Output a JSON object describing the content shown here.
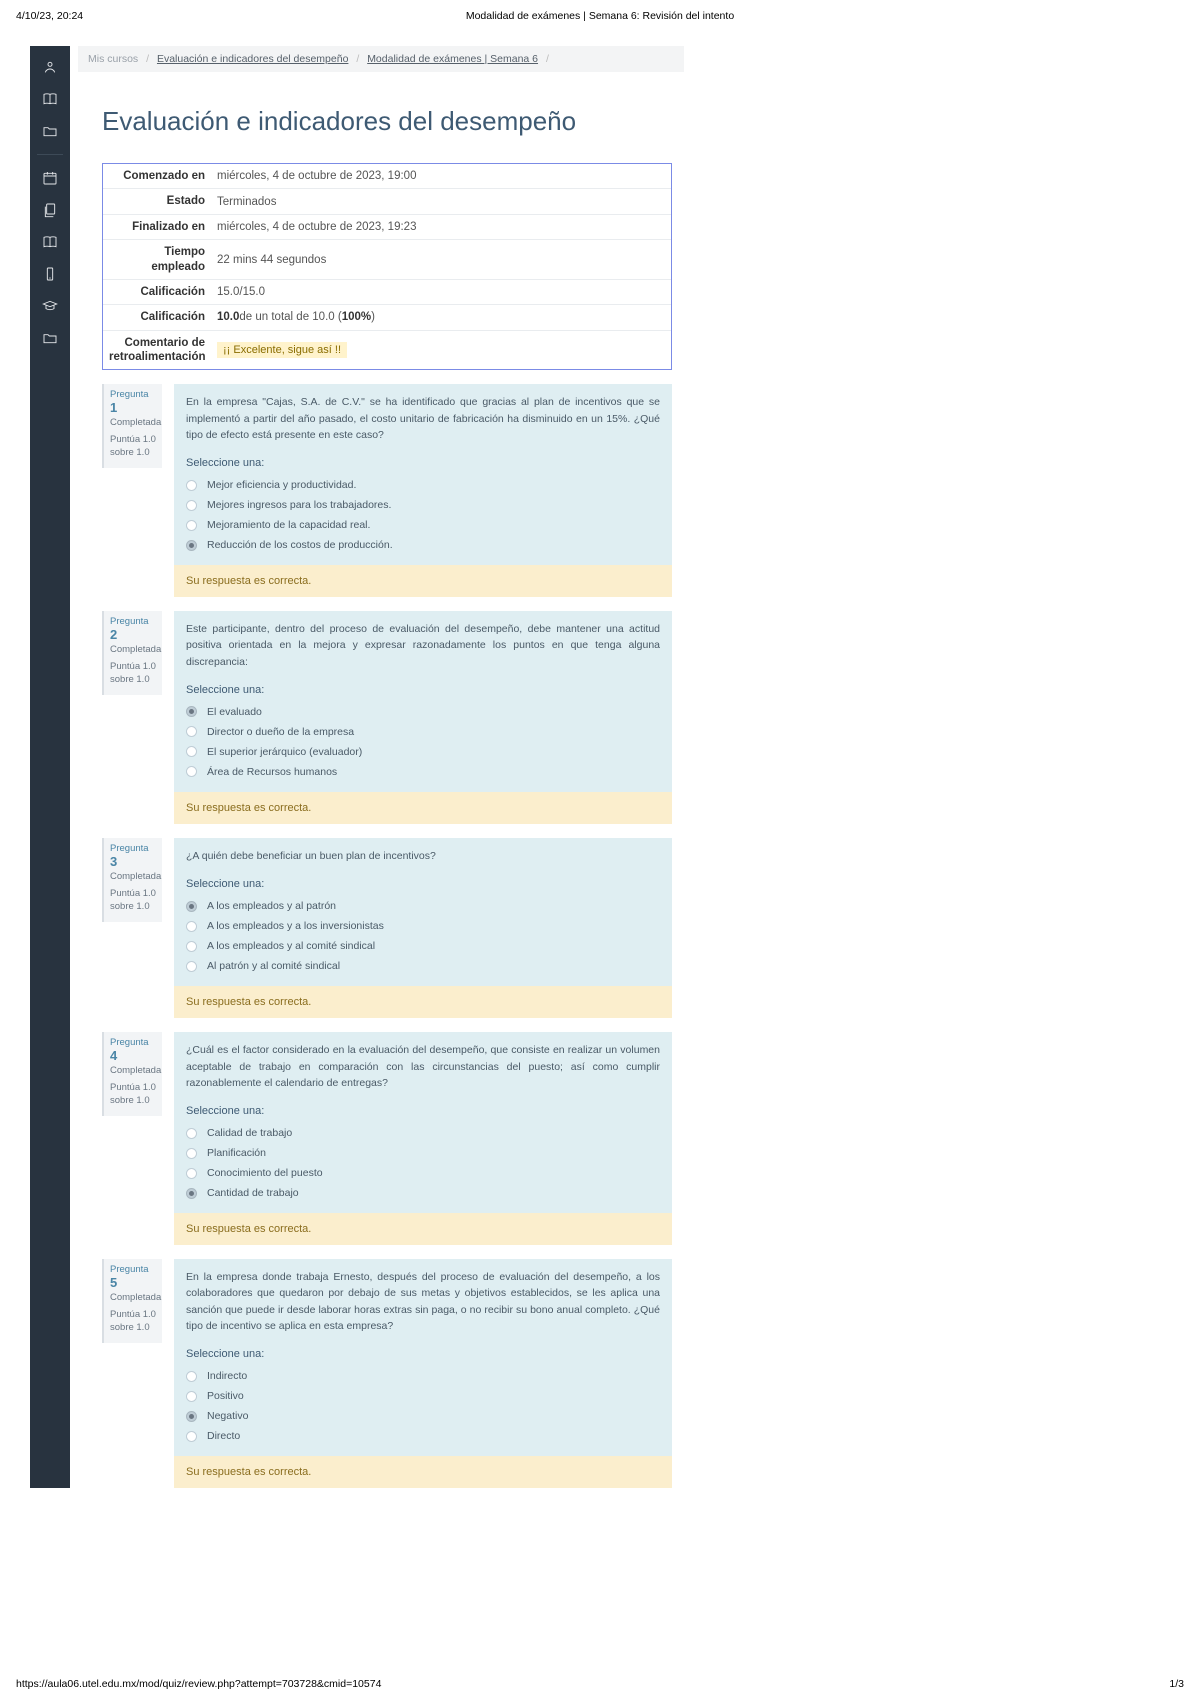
{
  "print": {
    "datetime": "4/10/23, 20:24",
    "title": "Modalidad de exámenes | Semana 6: Revisión del intento",
    "url": "https://aula06.utel.edu.mx/mod/quiz/review.php?attempt=703728&cmid=10574",
    "pagination": "1/3"
  },
  "breadcrumb": {
    "root": "Mis cursos",
    "course": "Evaluación e indicadores del desempeño",
    "page": "Modalidad de exámenes | Semana 6"
  },
  "page_title": "Evaluación e indicadores del desempeño",
  "summary": {
    "rows": [
      {
        "label": "Comenzado en",
        "value": "miércoles, 4 de octubre de 2023, 19:00"
      },
      {
        "label": "Estado",
        "value": "Terminados"
      },
      {
        "label": "Finalizado en",
        "value": "miércoles, 4 de octubre de 2023, 19:23"
      },
      {
        "label": "Tiempo empleado",
        "value": "22 mins 44 segundos"
      },
      {
        "label": "Calificación",
        "value": "15.0/15.0"
      },
      {
        "label": "Calificación",
        "value_html": "<b>10.0</b> de un total de 10.0 (<b>100%</b>)"
      },
      {
        "label": "Comentario de retroalimentación",
        "badge": "¡¡ Excelente, sigue así !!"
      }
    ]
  },
  "question_labels": {
    "label": "Pregunta",
    "status": "Completada",
    "score_prefix": "Puntúa 1.0 sobre 1.0",
    "prompt": "Seleccione una:",
    "correct": "Su respuesta es correcta."
  },
  "questions": [
    {
      "num": "1",
      "text": "En la empresa \"Cajas, S.A. de C.V.\" se ha identificado que gracias al plan de incentivos que se implementó a partir del año pasado, el costo unitario de fabricación ha disminuido en un 15%. ¿Qué tipo de efecto está presente en este caso?",
      "options": [
        {
          "label": "Mejor eficiencia y productividad.",
          "selected": false
        },
        {
          "label": "Mejores ingresos para los trabajadores.",
          "selected": false
        },
        {
          "label": "Mejoramiento de la capacidad real.",
          "selected": false
        },
        {
          "label": "Reducción de los costos de producción.",
          "selected": true
        }
      ]
    },
    {
      "num": "2",
      "text": "Este participante, dentro del proceso de evaluación del desempeño, debe mantener una actitud positiva orientada en la mejora y expresar razonadamente los puntos en que tenga alguna discrepancia:",
      "options": [
        {
          "label": "El evaluado",
          "selected": true
        },
        {
          "label": "Director o dueño de la empresa",
          "selected": false
        },
        {
          "label": "El superior jerárquico (evaluador)",
          "selected": false
        },
        {
          "label": "Área de Recursos humanos",
          "selected": false
        }
      ]
    },
    {
      "num": "3",
      "text": "¿A quién debe beneficiar un buen plan de incentivos?",
      "options": [
        {
          "label": "A los empleados y al patrón",
          "selected": true
        },
        {
          "label": "A los empleados y a los inversionistas",
          "selected": false
        },
        {
          "label": "A los empleados y al comité sindical",
          "selected": false
        },
        {
          "label": "Al patrón y al comité sindical",
          "selected": false
        }
      ]
    },
    {
      "num": "4",
      "text": "¿Cuál es el factor considerado en la evaluación del desempeño, que consiste en realizar un volumen aceptable de trabajo en comparación con las circunstancias del puesto; así como cumplir razonablemente el calendario de entregas?",
      "options": [
        {
          "label": "Calidad de trabajo",
          "selected": false
        },
        {
          "label": "Planificación",
          "selected": false
        },
        {
          "label": "Conocimiento del puesto",
          "selected": false
        },
        {
          "label": "Cantidad de trabajo",
          "selected": true
        }
      ]
    },
    {
      "num": "5",
      "text": "En la empresa donde trabaja Ernesto, después del proceso de evaluación del desempeño, a los colaboradores que quedaron por debajo de sus metas y objetivos establecidos, se les aplica una sanción que puede ir desde laborar horas extras sin paga, o no recibir su bono anual completo. ¿Qué tipo de incentivo se aplica en esta empresa?",
      "options": [
        {
          "label": "Indirecto",
          "selected": false
        },
        {
          "label": "Positivo",
          "selected": false
        },
        {
          "label": "Negativo",
          "selected": true
        },
        {
          "label": "Directo",
          "selected": false
        }
      ]
    }
  ]
}
